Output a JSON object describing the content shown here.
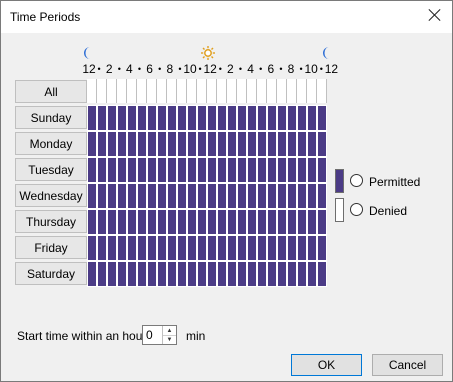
{
  "window": {
    "title": "Time Periods"
  },
  "hours": {
    "labels": [
      "12",
      "2",
      "4",
      "6",
      "8",
      "10",
      "12",
      "2",
      "4",
      "6",
      "8",
      "10",
      "12"
    ],
    "separator": "•",
    "icons": [
      "moon-icon",
      "sun-icon",
      "moon-icon"
    ]
  },
  "schedule": {
    "all_label": "All",
    "days": [
      "Sunday",
      "Monday",
      "Tuesday",
      "Wednesday",
      "Thursday",
      "Friday",
      "Saturday"
    ],
    "slots_per_day": 24,
    "state": "permitted"
  },
  "legend": {
    "permitted_label": "Permitted",
    "denied_label": "Denied",
    "permitted_color": "#4b3b86",
    "denied_color": "#ffffff"
  },
  "start": {
    "label": "Start time within an hour:",
    "value": "0",
    "unit": "min"
  },
  "buttons": {
    "ok": "OK",
    "cancel": "Cancel"
  },
  "colors": {
    "accent": "#4b3b86",
    "moon": "#2f6fd6",
    "sun": "#e0a020"
  }
}
